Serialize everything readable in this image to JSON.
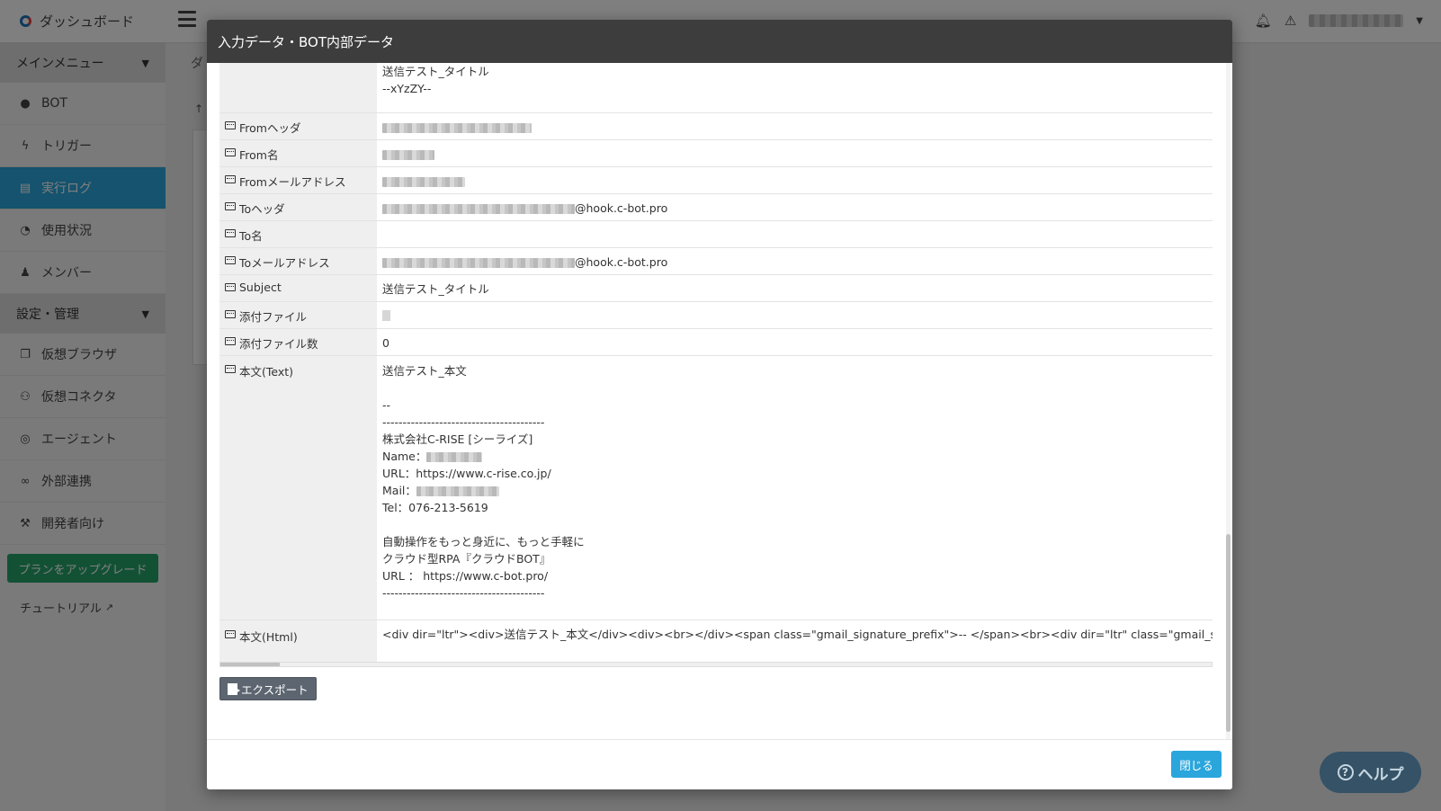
{
  "app": {
    "logo_text": "ダッシュボード"
  },
  "sidebar": {
    "main_menu_label": "メインメニュー",
    "main_items": [
      {
        "label": "BOT",
        "icon": "robot-icon"
      },
      {
        "label": "トリガー",
        "icon": "bolt-icon"
      },
      {
        "label": "実行ログ",
        "icon": "document-icon",
        "active": true
      },
      {
        "label": "使用状況",
        "icon": "pie-chart-icon"
      },
      {
        "label": "メンバー",
        "icon": "users-icon"
      }
    ],
    "settings_label": "設定・管理",
    "settings_items": [
      {
        "label": "仮想ブラウザ",
        "icon": "browser-icon"
      },
      {
        "label": "仮想コネクタ",
        "icon": "connector-icon"
      },
      {
        "label": "エージェント",
        "icon": "agent-icon"
      },
      {
        "label": "外部連携",
        "icon": "link-icon"
      },
      {
        "label": "開発者向け",
        "icon": "wrench-icon"
      }
    ],
    "upgrade_label": "プランをアップグレード",
    "tutorial_label": "チュートリアル"
  },
  "background": {
    "crumb": "ダ",
    "arrow": "↑"
  },
  "modal": {
    "title": "入力データ・BOT内部データ",
    "top_value": "送信テスト_タイトル\n--xYzZY--",
    "rows": {
      "from_header": {
        "key": "Fromヘッダ",
        "value": ""
      },
      "from_name": {
        "key": "From名",
        "value": ""
      },
      "from_address": {
        "key": "Fromメールアドレス",
        "value": ""
      },
      "to_header": {
        "key": "Toヘッダ",
        "value": "@hook.c-bot.pro"
      },
      "to_name": {
        "key": "To名",
        "value": ""
      },
      "to_address": {
        "key": "Toメールアドレス",
        "value": "@hook.c-bot.pro"
      },
      "subject": {
        "key": "Subject",
        "value": "送信テスト_タイトル"
      },
      "attachment": {
        "key": "添付ファイル",
        "value": ""
      },
      "attachment_count": {
        "key": "添付ファイル数",
        "value": "0"
      },
      "body_text": {
        "key": "本文(Text)",
        "line1": "送信テスト_本文\n\n--\n----------------------------------------\n株式会社C-RISE [シーライズ]",
        "name_label": "Name：",
        "url_line": "URL：https://www.c-rise.co.jp/",
        "mail_label": "Mail：",
        "line2": "Tel：076-213-5619\n\n自動操作をもっと身近に、もっと手軽に\nクラウド型RPA『クラウドBOT』\nURL ： https://www.c-bot.pro/\n----------------------------------------"
      },
      "body_html": {
        "key": "本文(Html)",
        "value": "<div dir=\"ltr\"><div>送信テスト_本文</div><div><br></div><span class=\"gmail_signature_prefix\">-- </span><br><div dir=\"ltr\" class=\"gmail_signature\" data-smartmail="
      }
    },
    "export_label": "エクスポート",
    "close_label": "閉じる"
  },
  "help": {
    "label": "ヘルプ"
  }
}
